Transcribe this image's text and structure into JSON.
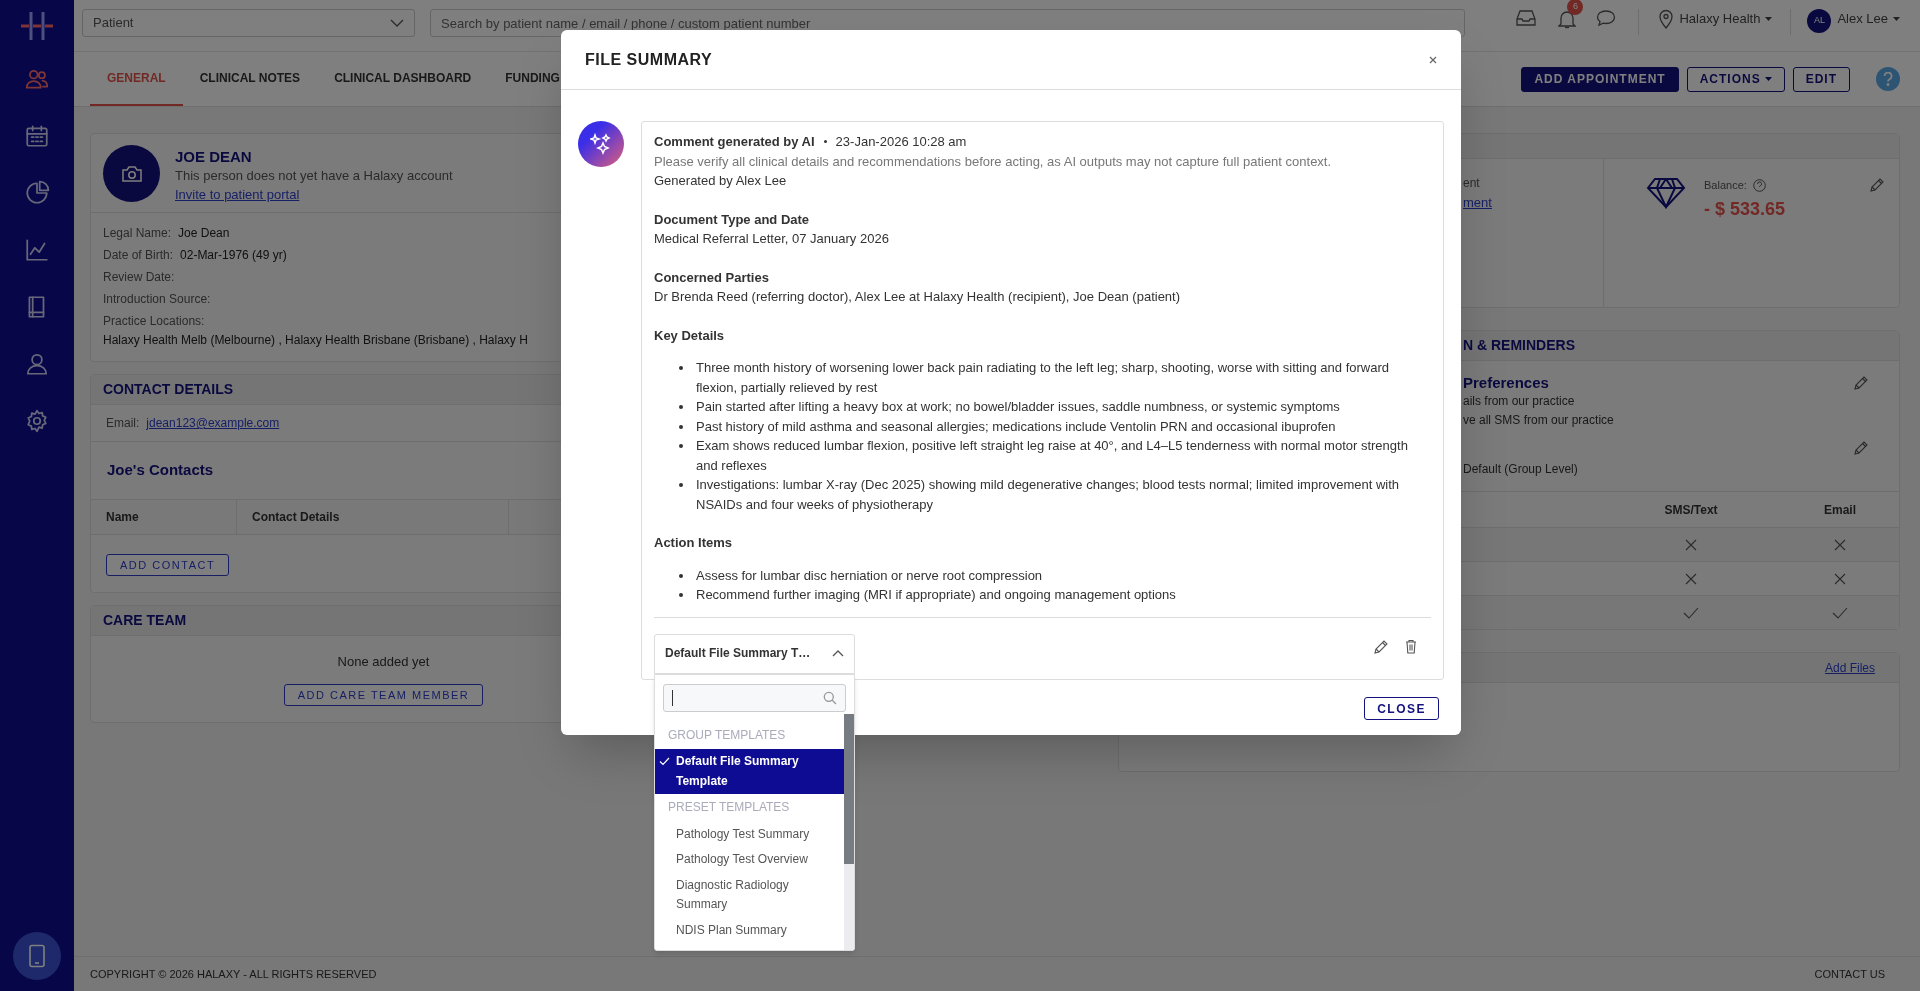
{
  "sidebar": {
    "items": [
      {
        "kind": "people",
        "selected": true
      },
      {
        "kind": "calendar",
        "selected": false
      },
      {
        "kind": "pie",
        "selected": false
      },
      {
        "kind": "line",
        "selected": false
      },
      {
        "kind": "book",
        "selected": false
      },
      {
        "kind": "user",
        "selected": false
      },
      {
        "kind": "gear",
        "selected": false
      }
    ]
  },
  "topbar": {
    "patient_select": "Patient",
    "search": {
      "placeholder": "Search by patient name / email / phone / custom patient number"
    },
    "notification_count": "6",
    "practice": "Halaxy Health",
    "user": {
      "initials": "AL",
      "name": "Alex Lee"
    }
  },
  "tabs": [
    {
      "label": "GENERAL",
      "selected": true
    },
    {
      "label": "CLINICAL NOTES",
      "selected": false
    },
    {
      "label": "CLINICAL DASHBOARD",
      "selected": false
    },
    {
      "label": "FUNDING",
      "selected": false
    }
  ],
  "actions": [
    {
      "label": "ADD APPOINTMENT",
      "kind": "primary"
    },
    {
      "label": "ACTIONS",
      "kind": "menu"
    },
    {
      "label": "EDIT",
      "kind": "outline"
    }
  ],
  "patient": {
    "name": "JOE DEAN",
    "account_note": "This person does not yet have a Halaxy account",
    "invite_link": "Invite to patient portal",
    "fields": [
      {
        "label": "Legal Name:",
        "value": "Joe Dean"
      },
      {
        "label": "Date of Birth:",
        "value": "02-Mar-1976 (49 yr)"
      },
      {
        "label": "Review Date:"
      },
      {
        "label": "Introduction Source:"
      }
    ],
    "locations_label": "Practice Locations:",
    "locations": "Halaxy Health Melb (Melbourne) , Halaxy Health Brisbane (Brisbane) , Halaxy H"
  },
  "contact_details": {
    "title": "CONTACT DETAILS",
    "email_label": "Email:",
    "email": "jdean123@example.com",
    "contacts_title": "Joe's Contacts",
    "columns": [
      "Name",
      "Contact Details"
    ],
    "add_button": "ADD CONTACT"
  },
  "care_team": {
    "title": "CARE TEAM",
    "empty": "None added yet",
    "add_button": "ADD CARE TEAM MEMBER"
  },
  "account_panel": {
    "fragment": "ent",
    "link_fragment": "ment",
    "balance_label": "Balance:",
    "balance": "- $ 533.65"
  },
  "reminders_panel": {
    "title_fragment": "N & REMINDERS",
    "preferences_fragment": "Preferences",
    "lines": [
      "ails from our practice",
      "ve all SMS from our practice"
    ],
    "group_fragment": "Default (Group Level)",
    "columns": [
      "SMS/Text",
      "Email"
    ],
    "rows": [
      {
        "sms": false,
        "email": false
      },
      {
        "sms": false,
        "email": false
      },
      {
        "sms": true,
        "email": true
      }
    ]
  },
  "files_panel": {
    "link": "Add Files"
  },
  "modal": {
    "title": "FILE SUMMARY",
    "comment": {
      "author": "Comment generated by AI",
      "timestamp": "23-Jan-2026 10:28 am",
      "disclaimer": "Please verify all clinical details and recommendations before acting, as AI outputs may not capture full patient context.",
      "generated_by": "Generated by Alex Lee",
      "sections": [
        {
          "heading": "Document Type and Date",
          "text": "Medical Referral Letter, 07 January 2026"
        },
        {
          "heading": "Concerned Parties",
          "text": "Dr Brenda Reed (referring doctor), Alex Lee at Halaxy Health (recipient), Joe Dean (patient)"
        },
        {
          "heading": "Key Details",
          "bullets": [
            "Three month history of worsening lower back pain radiating to the left leg; sharp, shooting, worse with sitting and forward flexion, partially relieved by rest",
            "Pain started after lifting a heavy box at work; no bowel/bladder issues, saddle numbness, or systemic symptoms",
            "Past history of mild asthma and seasonal allergies; medications include Ventolin PRN and occasional ibuprofen",
            "Exam shows reduced lumbar flexion, positive left straight leg raise at 40°, and L4–L5 tenderness with normal motor strength and reflexes",
            "Investigations: lumbar X-ray (Dec 2025) showing mild degenerative changes; blood tests normal; limited improvement with NSAIDs and four weeks of physiotherapy"
          ]
        },
        {
          "heading": "Action Items",
          "bullets": [
            "Assess for lumbar disc herniation or nerve root compression",
            "Recommend further imaging (MRI if appropriate) and ongoing management options"
          ]
        }
      ]
    },
    "template_select": {
      "value": "Default File Summary T…",
      "expanded": true,
      "groups": [
        {
          "label": "GROUP TEMPLATES",
          "options": [
            {
              "label": "Default File Summary Template",
              "selected": true
            }
          ]
        },
        {
          "label": "PRESET TEMPLATES",
          "options": [
            {
              "label": "Pathology Test Summary",
              "selected": false
            },
            {
              "label": "Pathology Test Overview",
              "selected": false
            },
            {
              "label": "Diagnostic Radiology Summary",
              "selected": false
            },
            {
              "label": "NDIS Plan Summary",
              "selected": false
            }
          ]
        }
      ]
    },
    "close_button": "CLOSE"
  },
  "footer": {
    "copyright": "COPYRIGHT © 2026 HALAXY - ALL RIGHTS RESERVED",
    "contact": "CONTACT US"
  }
}
